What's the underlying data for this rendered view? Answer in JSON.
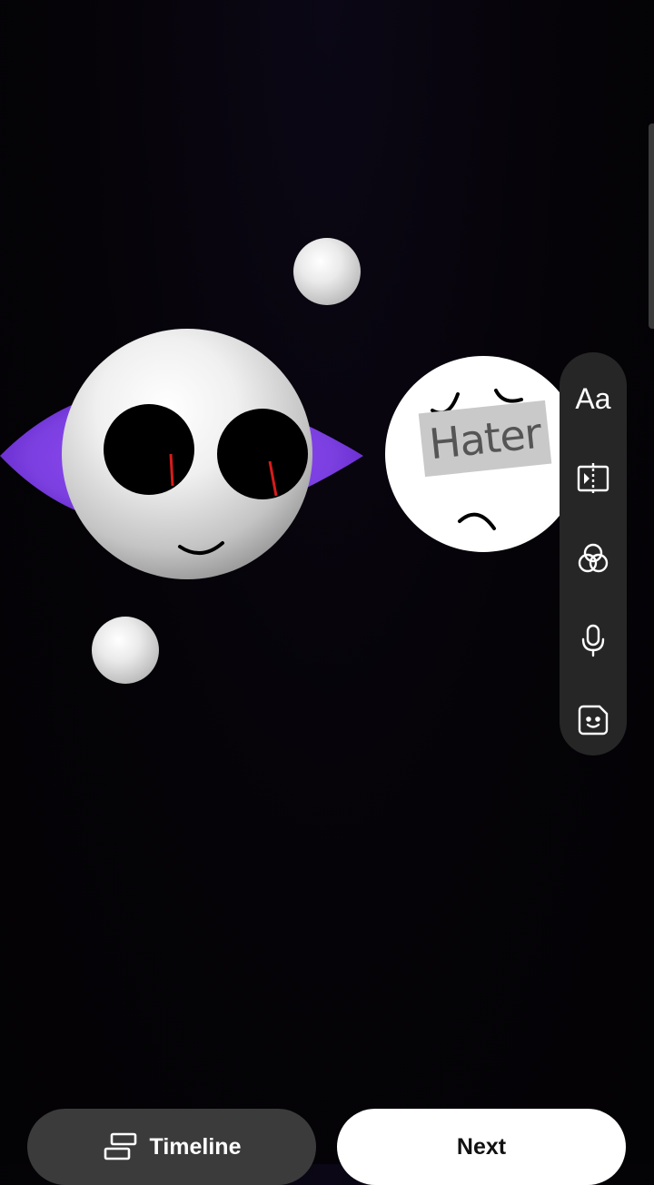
{
  "canvas": {
    "background": "#050307",
    "sticker_text": "Hater",
    "accent_purple": "#7b3fe0"
  },
  "tool_rail": {
    "items": [
      {
        "name": "text",
        "label": "Aa"
      },
      {
        "name": "clip",
        "icon": "clip-split-icon"
      },
      {
        "name": "filters",
        "icon": "filters-icon"
      },
      {
        "name": "voice",
        "icon": "microphone-icon"
      },
      {
        "name": "stickers",
        "icon": "sticker-icon"
      }
    ]
  },
  "bottom_bar": {
    "timeline_label": "Timeline",
    "next_label": "Next"
  }
}
